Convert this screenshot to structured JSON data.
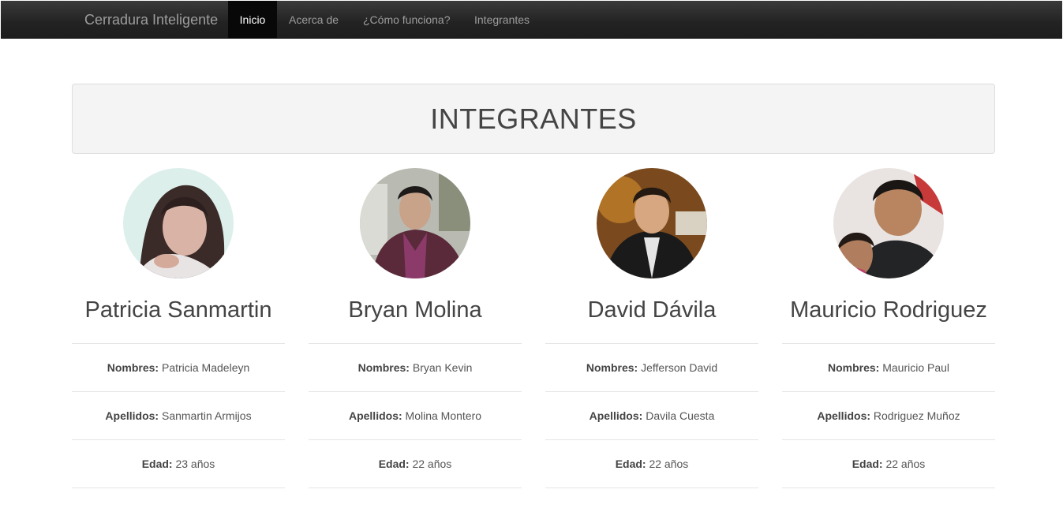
{
  "navbar": {
    "brand": "Cerradura Inteligente",
    "items": [
      {
        "label": "Inicio",
        "active": true
      },
      {
        "label": "Acerca de",
        "active": false
      },
      {
        "label": "¿Cómo funciona?",
        "active": false
      },
      {
        "label": "Integrantes",
        "active": false
      }
    ]
  },
  "page": {
    "title": "INTEGRANTES"
  },
  "labels": {
    "nombres": "Nombres:",
    "apellidos": "Apellidos:",
    "edad": "Edad:"
  },
  "members": [
    {
      "display_name": "Patricia Sanmartin",
      "nombres": "Patricia Madeleyn",
      "apellidos": "Sanmartin Armijos",
      "edad": "23 años"
    },
    {
      "display_name": "Bryan Molina",
      "nombres": "Bryan Kevin",
      "apellidos": "Molina Montero",
      "edad": "22 años"
    },
    {
      "display_name": "David Dávila",
      "nombres": "Jefferson David",
      "apellidos": "Davila Cuesta",
      "edad": "22 años"
    },
    {
      "display_name": "Mauricio Rodriguez",
      "nombres": "Mauricio Paul",
      "apellidos": "Rodriguez Muñoz",
      "edad": "22 años"
    }
  ],
  "colors": {
    "navbar_bg": "#222222",
    "navbar_active": "#080808",
    "jumbotron_bg": "#f4f4f4"
  }
}
